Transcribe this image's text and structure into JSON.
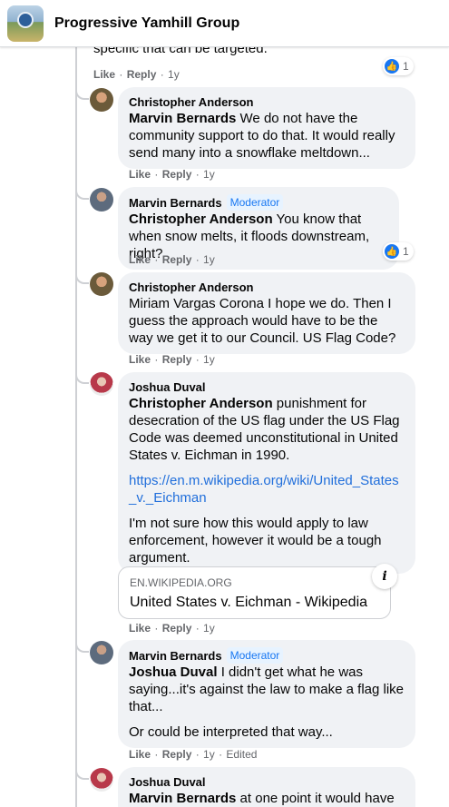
{
  "header": {
    "title": "Progressive Yamhill Group"
  },
  "top_snippet": "specific that can be targeted.",
  "top_actions": {
    "like": "Like",
    "reply": "Reply",
    "time": "1y"
  },
  "top_reaction": {
    "count": "1"
  },
  "comments": [
    {
      "author": "Christopher Anderson",
      "mention": "Marvin Bernards",
      "text": "We do not have the community support to do that. It would really send many into a snowflake meltdown...",
      "actions": {
        "like": "Like",
        "reply": "Reply",
        "time": "1y"
      }
    },
    {
      "author": "Marvin Bernards",
      "badge": "Moderator",
      "mention": "Christopher Anderson",
      "text": "You know that when snow melts, it floods downstream, right?",
      "reaction_count": "1",
      "actions": {
        "like": "Like",
        "reply": "Reply",
        "time": "1y"
      }
    },
    {
      "author": "Christopher Anderson",
      "text": "Miriam Vargas Corona I hope we do. Then I guess the approach would have to be the way we get it to our Council. US Flag Code?",
      "actions": {
        "like": "Like",
        "reply": "Reply",
        "time": "1y"
      }
    },
    {
      "author": "Joshua Duval",
      "mention": "Christopher Anderson",
      "text": "punishment for desecration of the US flag under the US Flag Code was deemed unconstitutional in United States v. Eichman in 1990.",
      "link": "https://en.m.wikipedia.org/wiki/United_States_v._Eichman",
      "text2": "I'm not sure how this would apply to law enforcement, however it would be a tough argument.",
      "preview": {
        "domain": "EN.WIKIPEDIA.ORG",
        "title": "United States v. Eichman - Wikipedia",
        "info": "i"
      },
      "actions": {
        "like": "Like",
        "reply": "Reply",
        "time": "1y"
      }
    },
    {
      "author": "Marvin Bernards",
      "badge": "Moderator",
      "mention": "Joshua Duval",
      "text": "I didn't get what he was saying...it's against the law to make a flag like that...",
      "text2": "Or could be interpreted that way...",
      "actions": {
        "like": "Like",
        "reply": "Reply",
        "time": "1y",
        "edited": "Edited"
      }
    },
    {
      "author": "Joshua Duval",
      "mention": "Marvin Bernards",
      "text": "at one point it would have"
    }
  ]
}
